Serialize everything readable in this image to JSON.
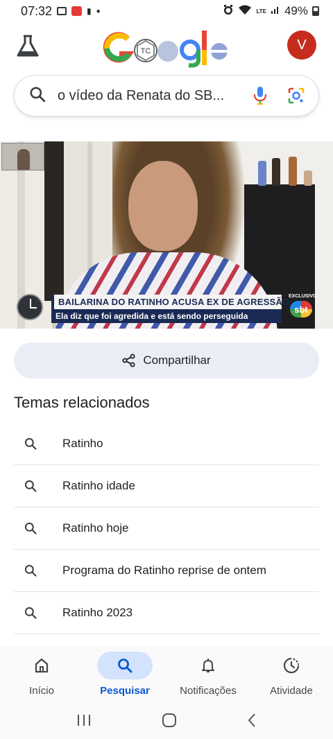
{
  "status_bar": {
    "time": "07:32",
    "battery": "49%",
    "network": "LTE"
  },
  "header": {
    "avatar_letter": "V",
    "doodle_letters": "TC"
  },
  "search": {
    "query": "o vídeo da Renata do SB..."
  },
  "video": {
    "headline": "BAILARINA DO RATINHO ACUSA EX DE AGRESSÃO",
    "subtitle": "Ela diz que foi agredida e está sendo perseguida",
    "badge": "EXCLUSIVO",
    "channel": "sbt"
  },
  "share": {
    "label": "Compartilhar"
  },
  "related": {
    "title": "Temas relacionados",
    "items": [
      {
        "label": "Ratinho"
      },
      {
        "label": "Ratinho idade"
      },
      {
        "label": "Ratinho hoje"
      },
      {
        "label": "Programa do Ratinho reprise de ontem"
      },
      {
        "label": "Ratinho 2023"
      }
    ]
  },
  "nav": {
    "items": [
      {
        "label": "Início",
        "icon": "home-icon"
      },
      {
        "label": "Pesquisar",
        "icon": "search-icon",
        "active": true
      },
      {
        "label": "Notificações",
        "icon": "bell-icon"
      },
      {
        "label": "Atividade",
        "icon": "activity-icon"
      }
    ]
  },
  "colors": {
    "accent": "#0b57d0",
    "active_pill": "#d3e3fd",
    "share_bg": "#e9eef6",
    "avatar_bg": "#c62d1f"
  }
}
